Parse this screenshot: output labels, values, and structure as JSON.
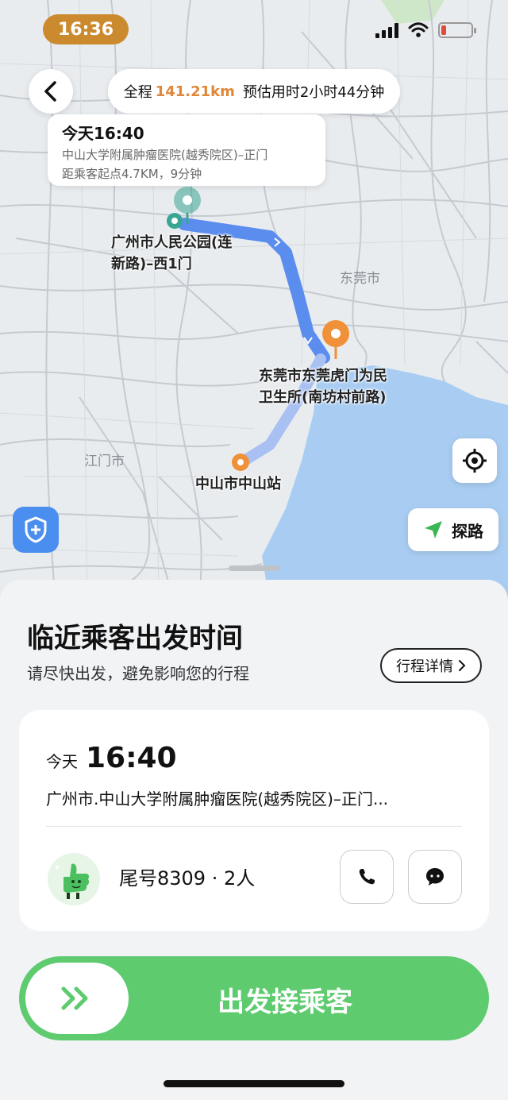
{
  "status_bar": {
    "time": "16:36"
  },
  "route_summary": {
    "prefix": "全程",
    "distance": "141.21km",
    "estimate": "预估用时2小时44分钟"
  },
  "pickup_card": {
    "time": "今天16:40",
    "address": "中山大学附属肿瘤医院(越秀院区)–正门",
    "distance_note": "距乘客起点4.7KM，9分钟"
  },
  "map": {
    "labels": [
      {
        "line1": "广州市人民公园(连",
        "line2": "新路)–西1门"
      },
      {
        "line1": "东莞市东莞虎门为民",
        "line2": "卫生所(南坊村前路)"
      },
      {
        "line1": "中山市中山站",
        "line2": ""
      }
    ],
    "cities": [
      "东莞市",
      "江门市"
    ],
    "explore_label": "探路",
    "colors": {
      "route": "#5b8def",
      "pickup_pin": "#3aa592",
      "stop_pin": "#f0913a",
      "water": "#a9cdf2"
    }
  },
  "sheet": {
    "title": "临近乘客出发时间",
    "subtitle": "请尽快出发，避免影响您的行程",
    "detail_button": "行程详情",
    "trip": {
      "day": "今天",
      "time": "16:40",
      "address": "广州市.中山大学附属肿瘤医院(越秀院区)–正门...",
      "passenger": "尾号8309 · 2人"
    },
    "go_button": "出发接乘客"
  },
  "icons": [
    "back-arrow-icon",
    "signal-icon",
    "wifi-icon",
    "battery-icon",
    "locate-icon",
    "shield-icon",
    "navigate-arrow-icon",
    "phone-icon",
    "chat-icon",
    "double-chevron-icon"
  ]
}
